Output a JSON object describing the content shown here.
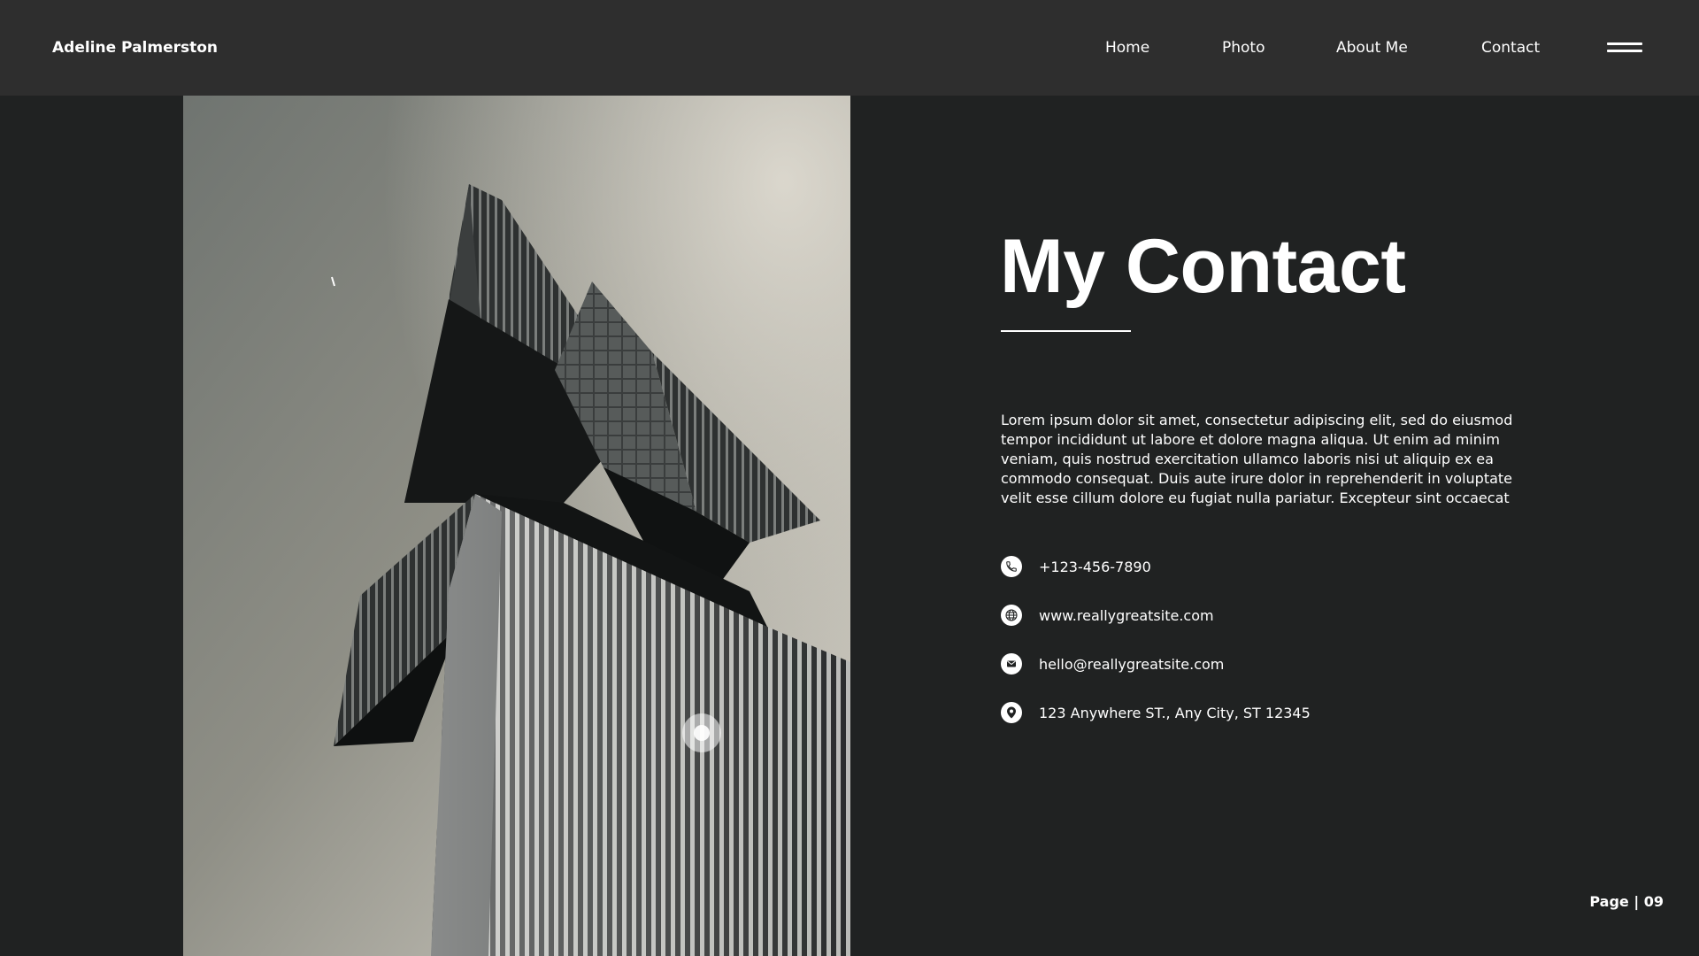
{
  "header": {
    "brand": "Adeline Palmerston",
    "nav": [
      {
        "label": "Home"
      },
      {
        "label": "Photo"
      },
      {
        "label": "About Me"
      },
      {
        "label": "Contact"
      }
    ],
    "menu_icon": "hamburger-menu-icon"
  },
  "photo": {
    "subject": "architecture-photo",
    "tone": "monochrome"
  },
  "content": {
    "title": "My Contact",
    "intro": "Lorem ipsum dolor sit amet, consectetur adipiscing elit, sed do eiusmod tempor incididunt ut labore et dolore magna aliqua. Ut enim ad minim veniam, quis nostrud exercitation ullamco laboris nisi ut aliquip ex ea commodo consequat. Duis aute irure dolor in reprehenderit in voluptate velit esse cillum dolore eu fugiat nulla pariatur. Excepteur sint occaecat",
    "contacts": [
      {
        "icon": "phone-icon",
        "text": "+123-456-7890"
      },
      {
        "icon": "globe-icon",
        "text": "www.reallygreatsite.com"
      },
      {
        "icon": "mail-icon",
        "text": "hello@reallygreatsite.com"
      },
      {
        "icon": "location-pin-icon",
        "text": "123 Anywhere ST., Any City, ST 12345"
      }
    ]
  },
  "footer": {
    "page_label": "Page | 09"
  },
  "colors": {
    "background": "#202222",
    "header_bg": "#2e2e2e",
    "text": "#ffffff"
  }
}
